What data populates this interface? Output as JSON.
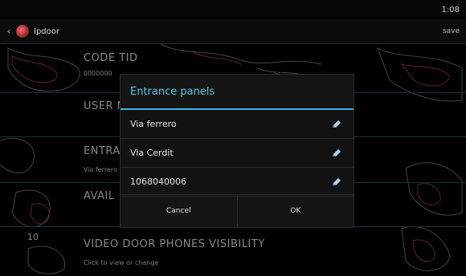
{
  "status": {
    "time": "1:08"
  },
  "actionbar": {
    "title": "Ipdoor",
    "save": "save",
    "back_icon": "chevron-left-icon",
    "logo_icon": "app-logo-icon"
  },
  "settings": {
    "code": {
      "label": "CODE TID",
      "value": "0000000"
    },
    "user": {
      "label": "USER N"
    },
    "entrance": {
      "label": "ENTRA",
      "value": "Via ferrero"
    },
    "available": {
      "label": "AVAIL"
    },
    "visibility": {
      "number": "10",
      "label": "VIDEO DOOR PHONES VISIBILITY",
      "value": "Click to view or change"
    }
  },
  "dialog": {
    "title": "Entrance panels",
    "items": [
      {
        "label": "Via ferrero",
        "icon": "edit-icon"
      },
      {
        "label": "Via Cerdit",
        "icon": "edit-icon"
      },
      {
        "label": "1068040006",
        "icon": "edit-icon"
      }
    ],
    "cancel": "Cancel",
    "ok": "OK"
  },
  "colors": {
    "accent": "#33b5e5",
    "background": "#000000",
    "map_line_red": "#b23b4a",
    "map_line_gray": "#8a8f96"
  }
}
